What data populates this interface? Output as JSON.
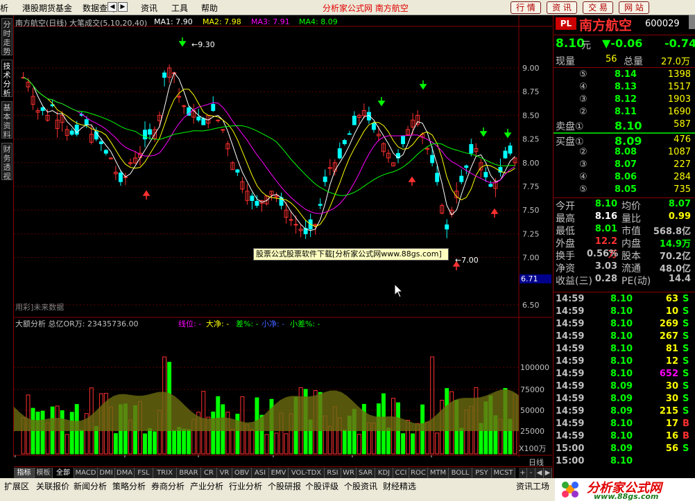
{
  "menu": {
    "items": [
      "析",
      "港股期货基金",
      "数据查询",
      "资讯",
      "工具",
      "帮助"
    ],
    "title": "分析家公式网  南方航空",
    "buttons": [
      "行 情",
      "资 讯",
      "交 易",
      "网 站"
    ]
  },
  "left_tabs": [
    "分时走势",
    "技术分析",
    "基本资料",
    "财务透视"
  ],
  "chart": {
    "header": "南方航空(日线) 大笔成交(5,10,20,40)",
    "ma": [
      {
        "label": "MA1: 7.90",
        "color": "#ffffff"
      },
      {
        "label": "MA2: 7.98",
        "color": "#ffff00"
      },
      {
        "label": "MA3: 7.91",
        "color": "#ff00ff"
      },
      {
        "label": "MA4: 8.09",
        "color": "#00ff00"
      }
    ],
    "price_axis": [
      "9.00",
      "8.75",
      "8.50",
      "8.25",
      "8.00",
      "7.75",
      "7.50",
      "7.25",
      "7.00",
      "6.50"
    ],
    "price_tag": "6.71",
    "high_label": "9.30",
    "low_label": "7.00",
    "future_note": "用彩]未来数据",
    "tooltip": "股票公式股票软件下载[分析家公式网www.88gs.com]",
    "sub_header": "大额分析    总亿OR万: 23435736.00",
    "sub_legend": [
      {
        "text": "线位: -",
        "color": "#ff00ff"
      },
      {
        "text": "大净: -",
        "color": "#ffff00"
      },
      {
        "text": "差%: -",
        "color": "#00ff00"
      },
      {
        "text": "小净: -",
        "color": "#0000ff"
      },
      {
        "text": "小差%: -",
        "color": "#00ff00"
      }
    ],
    "vol_axis": [
      "100000",
      "75000",
      "50000",
      "25000"
    ],
    "vol_unit": "X100万",
    "date_labels": [
      "2011年",
      "4",
      "5",
      "6",
      "7",
      "8"
    ],
    "period": "日线"
  },
  "chart_data": {
    "type": "candlestick",
    "title": "南方航空(日线)",
    "ylim": [
      6.4,
      9.3
    ],
    "price_range": {
      "high": 9.3,
      "low": 7.0,
      "last": 8.1
    },
    "months": [
      "2011年",
      "4",
      "5",
      "6",
      "7",
      "8"
    ],
    "ma_last": {
      "MA1": 7.9,
      "MA2": 7.98,
      "MA3": 7.91,
      "MA4": 8.09
    }
  },
  "bottom_tabs": [
    "指标",
    "模板",
    "全部",
    "MACD",
    "DMI",
    "DMA",
    "FSL",
    "TRIX",
    "BRAR",
    "CR",
    "VR",
    "OBV",
    "ASI",
    "EMV",
    "VOL-TDX",
    "RSI",
    "WR",
    "SAR",
    "KDJ",
    "CCI",
    "ROC",
    "MTM",
    "BOLL",
    "PSY",
    "MCST"
  ],
  "status_tabs": [
    "扩展区",
    "关联报价",
    "新闻分析",
    "策略分析",
    "券商分析",
    "产业分析",
    "行业分析",
    "个股研报",
    "个股评级",
    "个股资讯",
    "财经精选",
    "资讯工场"
  ],
  "quote": {
    "code_badge": "PL",
    "name": "南方航空",
    "code": "600029",
    "price": "8.10",
    "price_unit": "元",
    "change": "▼-0.06",
    "change_pct": "-0.74",
    "xianliang_label": "现量",
    "xianliang": "56",
    "zongliang_label": "总量",
    "zongliang": "27.0万",
    "sells": [
      {
        "label": "⑤",
        "price": "8.14",
        "vol": "1398"
      },
      {
        "label": "④",
        "price": "8.13",
        "vol": "1517"
      },
      {
        "label": "③",
        "price": "8.12",
        "vol": "1903"
      },
      {
        "label": "②",
        "price": "8.11",
        "vol": "1690"
      },
      {
        "label": "卖盘①",
        "price": "8.10",
        "vol": "587"
      }
    ],
    "buys": [
      {
        "label": "买盘①",
        "price": "8.09",
        "vol": "476"
      },
      {
        "label": "②",
        "price": "8.08",
        "vol": "1087"
      },
      {
        "label": "③",
        "price": "8.07",
        "vol": "227"
      },
      {
        "label": "④",
        "price": "8.06",
        "vol": "284"
      },
      {
        "label": "⑤",
        "price": "8.05",
        "vol": "735"
      }
    ],
    "stats": [
      {
        "l1": "今开",
        "v1": "8.10",
        "c1": "#00ff00",
        "l2": "均价",
        "v2": "8.07",
        "c2": "#00ff00"
      },
      {
        "l1": "最高",
        "v1": "8.16",
        "c1": "#ffffff",
        "l2": "量比",
        "v2": "0.99",
        "c2": "#ffff00"
      },
      {
        "l1": "最低",
        "v1": "8.01",
        "c1": "#00ff00",
        "l2": "市值",
        "v2": "568.8亿",
        "c2": "#c0c0c0"
      },
      {
        "l1": "外盘",
        "v1": "12.2万",
        "c1": "#ff3030",
        "l2": "内盘",
        "v2": "14.9万",
        "c2": "#00ff00"
      },
      {
        "l1": "换手",
        "v1": "0.56%",
        "c1": "#c0c0c0",
        "l2": "股本",
        "v2": "70.2亿",
        "c2": "#c0c0c0"
      },
      {
        "l1": "净资",
        "v1": "3.03",
        "c1": "#c0c0c0",
        "l2": "流通",
        "v2": "48.0亿",
        "c2": "#c0c0c0"
      },
      {
        "l1": "收益(三)",
        "v1": "0.28",
        "c1": "#c0c0c0",
        "l2": "PE(动)",
        "v2": "14.4",
        "c2": "#c0c0c0"
      }
    ],
    "ticks": [
      {
        "t": "14:59",
        "p": "8.10",
        "v": "63",
        "s": "S",
        "pc": "#00ff00",
        "vc": "#ffff00",
        "sc": "#00ff00"
      },
      {
        "t": "14:59",
        "p": "8.10",
        "v": "10",
        "s": "S",
        "pc": "#00ff00",
        "vc": "#ffff00",
        "sc": "#00ff00"
      },
      {
        "t": "14:59",
        "p": "8.10",
        "v": "269",
        "s": "S",
        "pc": "#00ff00",
        "vc": "#ffff00",
        "sc": "#00ff00"
      },
      {
        "t": "14:59",
        "p": "8.10",
        "v": "267",
        "s": "S",
        "pc": "#00ff00",
        "vc": "#ffff00",
        "sc": "#00ff00"
      },
      {
        "t": "14:59",
        "p": "8.10",
        "v": "81",
        "s": "S",
        "pc": "#00ff00",
        "vc": "#ffff00",
        "sc": "#00ff00"
      },
      {
        "t": "14:59",
        "p": "8.10",
        "v": "12",
        "s": "S",
        "pc": "#00ff00",
        "vc": "#ffff00",
        "sc": "#00ff00"
      },
      {
        "t": "14:59",
        "p": "8.10",
        "v": "652",
        "s": "S",
        "pc": "#00ff00",
        "vc": "#ff00ff",
        "sc": "#00ff00"
      },
      {
        "t": "14:59",
        "p": "8.09",
        "v": "30",
        "s": "S",
        "pc": "#00ff00",
        "vc": "#ffff00",
        "sc": "#00ff00"
      },
      {
        "t": "14:59",
        "p": "8.09",
        "v": "30",
        "s": "S",
        "pc": "#00ff00",
        "vc": "#ffff00",
        "sc": "#00ff00"
      },
      {
        "t": "14:59",
        "p": "8.09",
        "v": "215",
        "s": "S",
        "pc": "#00ff00",
        "vc": "#ffff00",
        "sc": "#00ff00"
      },
      {
        "t": "14:59",
        "p": "8.10",
        "v": "17",
        "s": "B",
        "pc": "#00ff00",
        "vc": "#ffff00",
        "sc": "#ff3030"
      },
      {
        "t": "14:59",
        "p": "8.10",
        "v": "16",
        "s": "B",
        "pc": "#00ff00",
        "vc": "#ffff00",
        "sc": "#ff3030"
      },
      {
        "t": "15:00",
        "p": "8.09",
        "v": "56",
        "s": "S",
        "pc": "#00ff00",
        "vc": "#ffff00",
        "sc": "#00ff00"
      },
      {
        "t": "15:00",
        "p": "8.10",
        "v": "",
        "s": "",
        "pc": "#00ff00",
        "vc": "#ffff00",
        "sc": "#00ff00"
      }
    ]
  },
  "logo": {
    "text": "分析家公式网",
    "url": "www.88gs.com"
  }
}
